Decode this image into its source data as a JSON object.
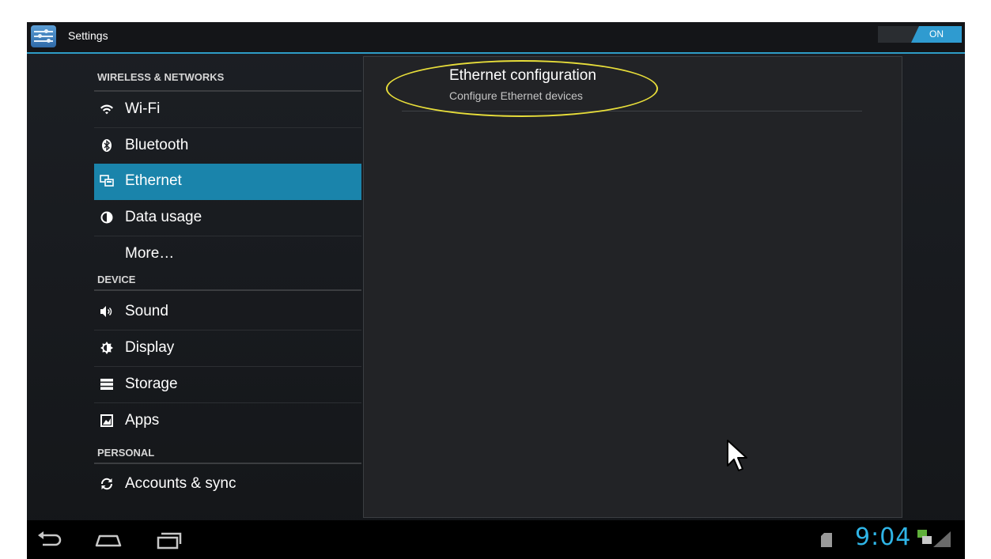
{
  "actionbar": {
    "title": "Settings",
    "switch_label": "ON"
  },
  "sidebar": {
    "headers": [
      "WIRELESS & NETWORKS",
      "DEVICE",
      "PERSONAL"
    ],
    "items": [
      {
        "label": "Wi-Fi",
        "icon": "wifi-icon"
      },
      {
        "label": "Bluetooth",
        "icon": "bluetooth-icon"
      },
      {
        "label": "Ethernet",
        "icon": "ethernet-icon",
        "selected": true
      },
      {
        "label": "Data usage",
        "icon": "data-usage-icon"
      },
      {
        "label": "More…",
        "icon": ""
      },
      {
        "label": "Sound",
        "icon": "sound-icon"
      },
      {
        "label": "Display",
        "icon": "display-icon"
      },
      {
        "label": "Storage",
        "icon": "storage-icon"
      },
      {
        "label": "Apps",
        "icon": "apps-icon"
      },
      {
        "label": "Accounts & sync",
        "icon": "sync-icon"
      }
    ]
  },
  "detail": {
    "title": "Ethernet configuration",
    "summary": "Configure Ethernet devices"
  },
  "statusbar": {
    "time": "9:04"
  },
  "colors": {
    "accent": "#2e9cc6",
    "selected": "#1a84ab",
    "highlight": "#e8de3a",
    "clock": "#2fb4e6"
  }
}
